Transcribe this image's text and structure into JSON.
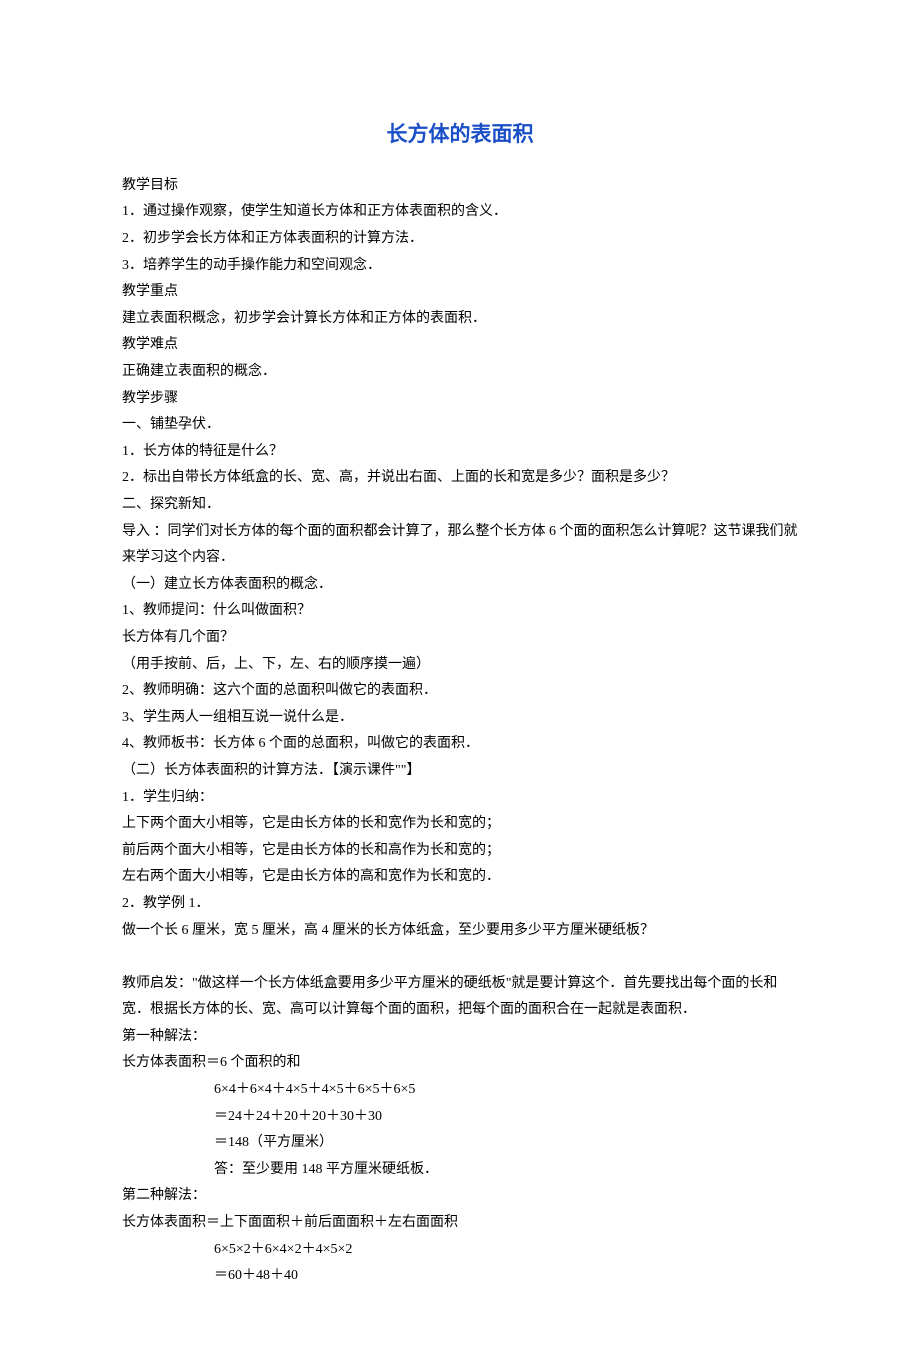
{
  "title": "长方体的表面积",
  "lines": {
    "l1": "教学目标",
    "l2": "1．通过操作观察，使学生知道长方体和正方体表面积的含义．",
    "l3": "2．初步学会长方体和正方体表面积的计算方法．",
    "l4": "3．培养学生的动手操作能力和空间观念．",
    "l5": "教学重点",
    "l6": "建立表面积概念，初步学会计算长方体和正方体的表面积．",
    "l7": "教学难点",
    "l8": "正确建立表面积的概念．",
    "l9": "教学步骤",
    "l10": "一、铺垫孕伏．",
    "l11": "1．长方体的特征是什么？",
    "l12": "2．标出自带长方体纸盒的长、宽、高，并说出右面、上面的长和宽是多少？面积是多少？",
    "l13": "二、探究新知．",
    "l14": "导入 ：同学们对长方体的每个面的面积都会计算了，那么整个长方体 6 个面的面积怎么计算呢？这节课我们就来学习这个内容．",
    "l15": "（一）建立长方体表面积的概念．",
    "l16": "1、教师提问：什么叫做面积？",
    "l17": "长方体有几个面？",
    "l18": "（用手按前、后，上、下，左、右的顺序摸一遍）",
    "l19": "2、教师明确：这六个面的总面积叫做它的表面积．",
    "l20": "3、学生两人一组相互说一说什么是．",
    "l21": "4、教师板书：长方体 6 个面的总面积，叫做它的表面积．",
    "l22": "（二）长方体表面积的计算方法．【演示课件\"\"】",
    "l23": "1．学生归纳：",
    "l24": "上下两个面大小相等，它是由长方体的长和宽作为长和宽的；",
    "l25": "前后两个面大小相等，它是由长方体的长和高作为长和宽的；",
    "l26": "左右两个面大小相等，它是由长方体的高和宽作为长和宽的．",
    "l27": "2．教学例 1．",
    "l28": "做一个长 6 厘米，宽 5 厘米，高 4 厘米的长方体纸盒，至少要用多少平方厘米硬纸板？",
    "l29_blank": " ",
    "l30": "教师启发：\"做这样一个长方体纸盒要用多少平方厘米的硬纸板\"就是要计算这个．首先要找出每个面的长和宽．根据长方体的长、宽、高可以计算每个面的面积，把每个面的面积合在一起就是表面积．",
    "l31": "第一种解法：",
    "l32": "长方体表面积＝6 个面积的和",
    "l33": "6×4＋6×4＋4×5＋4×5＋6×5＋6×5",
    "l34": "＝24＋24＋20＋20＋30＋30",
    "l35": "＝148（平方厘米）",
    "l36": "答：至少要用 148 平方厘米硬纸板．",
    "l37": "第二种解法：",
    "l38": "长方体表面积＝上下面面积＋前后面面积＋左右面面积",
    "l39": "6×5×2＋6×4×2＋4×5×2",
    "l40": "＝60＋48＋40"
  }
}
